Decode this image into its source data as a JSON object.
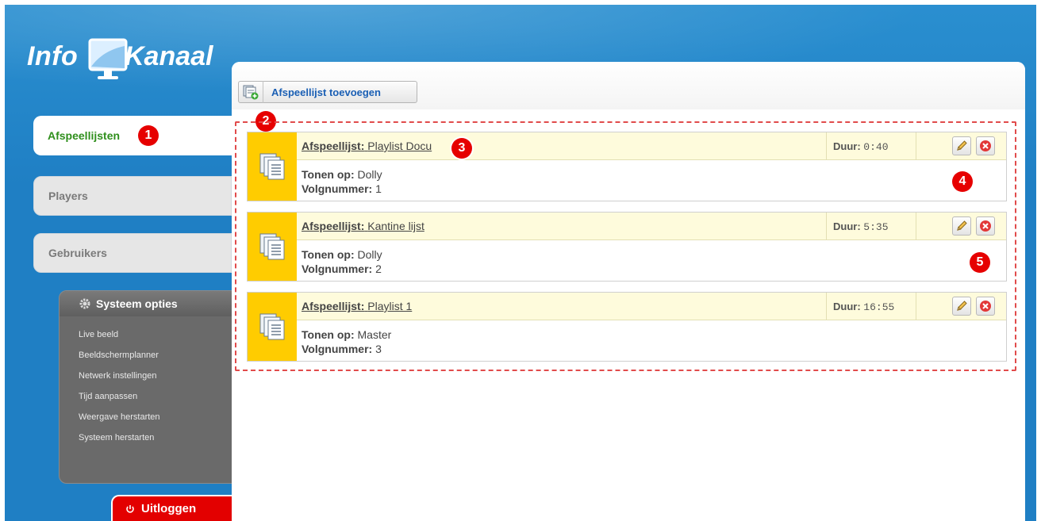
{
  "logo": {
    "part1": "Info",
    "part2": "Kanaal"
  },
  "nav": {
    "items": [
      {
        "label": "Afspeellijsten",
        "active": true
      },
      {
        "label": "Players",
        "active": false
      },
      {
        "label": "Gebruikers",
        "active": false
      }
    ]
  },
  "system": {
    "title": "Systeem opties",
    "items": [
      "Live beeld",
      "Beeldschermplanner",
      "Netwerk instellingen",
      "Tijd aanpassen",
      "Weergave herstarten",
      "Systeem herstarten"
    ]
  },
  "logout": {
    "label": "Uitloggen"
  },
  "toolbar": {
    "add_label": "Afspeellijst toevoegen"
  },
  "labels": {
    "playlist": "Afspeellijst:",
    "duration": "Duur:",
    "shown_on": "Tonen op:",
    "sequence": "Volgnummer:"
  },
  "playlists": [
    {
      "name": "Playlist Docu",
      "duration": "0:40",
      "shown_on": "Dolly",
      "sequence": "1"
    },
    {
      "name": "Kantine lijst",
      "duration": "5:35",
      "shown_on": "Dolly",
      "sequence": "2"
    },
    {
      "name": "Playlist 1",
      "duration": "16:55",
      "shown_on": "Master",
      "sequence": "3"
    }
  ],
  "badges": [
    "1",
    "2",
    "3",
    "4",
    "5"
  ],
  "colors": {
    "background_blue": "#1f7fc4",
    "active_tab_text": "#2f8f1c",
    "badge_red": "#e60000",
    "playlist_icon_bg": "#ffcc00",
    "dashed_border": "#e14b4b",
    "add_link": "#1a5fb4"
  },
  "icons": {
    "add": "add-playlist-icon",
    "edit": "pencil-icon",
    "delete": "delete-icon",
    "settings": "gear-icon",
    "power": "power-icon",
    "arrow": "arrow-right-icon",
    "playlist": "playlist-icon"
  }
}
